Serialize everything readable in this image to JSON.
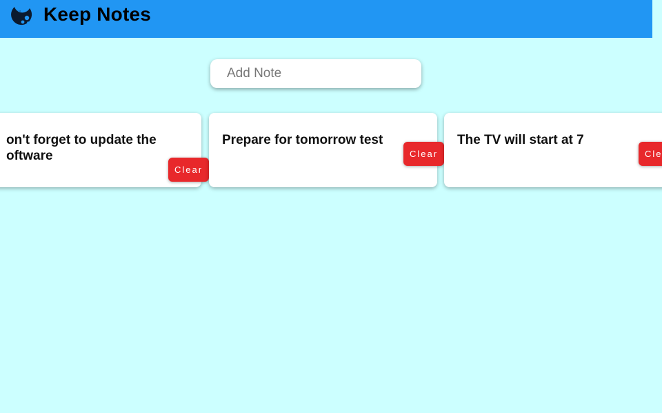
{
  "header": {
    "title": "Keep Notes",
    "logo_icon": "keep-notes-logo",
    "background": "#2196f3"
  },
  "input": {
    "placeholder": "Add Note"
  },
  "notes": [
    {
      "text": "on't forget to update the oftware",
      "line1": "on't forget to update the",
      "line2": "oftware",
      "clear_label": "Clear"
    },
    {
      "text": "Prepare for tomorrow test",
      "clear_label": "Clear"
    },
    {
      "text": "The TV will start at 7",
      "clear_label": "Cle"
    }
  ],
  "colors": {
    "page_background": "#ccffff",
    "clear_button": "#e8282b"
  }
}
